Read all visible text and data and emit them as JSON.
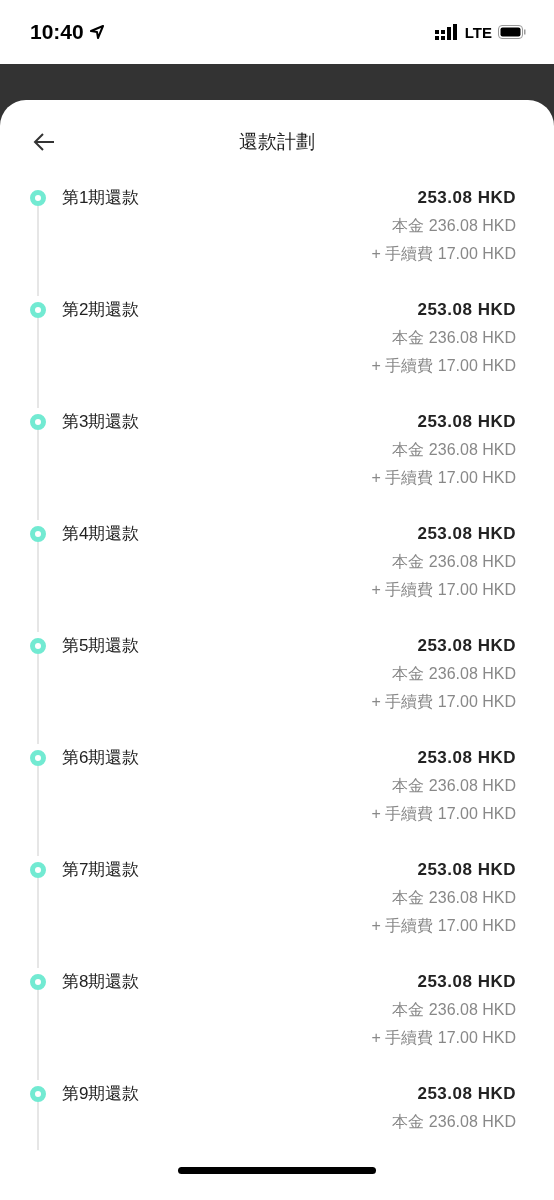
{
  "status_bar": {
    "time": "10:40",
    "network": "LTE"
  },
  "title": "還款計劃",
  "installments": [
    {
      "label": "第1期還款",
      "amount": "253.08 HKD",
      "principal": "本金 236.08 HKD",
      "fee": "+ 手續費 17.00 HKD"
    },
    {
      "label": "第2期還款",
      "amount": "253.08 HKD",
      "principal": "本金 236.08 HKD",
      "fee": "+ 手續費 17.00 HKD"
    },
    {
      "label": "第3期還款",
      "amount": "253.08 HKD",
      "principal": "本金 236.08 HKD",
      "fee": "+ 手續費 17.00 HKD"
    },
    {
      "label": "第4期還款",
      "amount": "253.08 HKD",
      "principal": "本金 236.08 HKD",
      "fee": "+ 手續費 17.00 HKD"
    },
    {
      "label": "第5期還款",
      "amount": "253.08 HKD",
      "principal": "本金 236.08 HKD",
      "fee": "+ 手續費 17.00 HKD"
    },
    {
      "label": "第6期還款",
      "amount": "253.08 HKD",
      "principal": "本金 236.08 HKD",
      "fee": "+ 手續費 17.00 HKD"
    },
    {
      "label": "第7期還款",
      "amount": "253.08 HKD",
      "principal": "本金 236.08 HKD",
      "fee": "+ 手續費 17.00 HKD"
    },
    {
      "label": "第8期還款",
      "amount": "253.08 HKD",
      "principal": "本金 236.08 HKD",
      "fee": "+ 手續費 17.00 HKD"
    },
    {
      "label": "第9期還款",
      "amount": "253.08 HKD",
      "principal": "本金 236.08 HKD"
    }
  ]
}
